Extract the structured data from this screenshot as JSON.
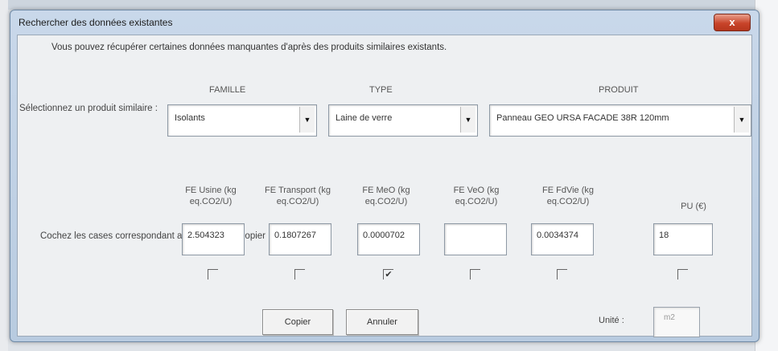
{
  "window": {
    "title": "Rechercher des données existantes",
    "close_label": "x"
  },
  "intro": {
    "text": "Vous pouvez récupérer certaines données manquantes d'après des produits similaires existants."
  },
  "columns": {
    "famille": "FAMILLE",
    "type": "TYPE",
    "produit": "PRODUIT"
  },
  "selection": {
    "label": "Sélectionnez un produit similaire :",
    "famille_value": "Isolants",
    "type_value": "Laine de verre",
    "produit_value": "Panneau GEO URSA FACADE 38R 120mm"
  },
  "copy_label": "Cochez les cases correspondant aux données à copier :",
  "fields": [
    {
      "header": "FE Usine (kg eq.CO2/U)",
      "value": "2.504323",
      "checked": false
    },
    {
      "header": "FE Transport (kg eq.CO2/U)",
      "value": "0.1807267",
      "checked": false
    },
    {
      "header": "FE MeO (kg eq.CO2/U)",
      "value": "0.0000702",
      "checked": true
    },
    {
      "header": "FE VeO (kg eq.CO2/U)",
      "value": "",
      "checked": false
    },
    {
      "header": "FE FdVie (kg eq.CO2/U)",
      "value": "0.0034374",
      "checked": false
    },
    {
      "header": "PU (€)",
      "value": "18",
      "checked": false
    }
  ],
  "buttons": {
    "copier": "Copier",
    "annuler": "Annuler"
  },
  "unit": {
    "label": "Unité :",
    "value": "m2"
  },
  "icons": {
    "dropdown": "chevron-down-icon",
    "close": "close-icon"
  }
}
